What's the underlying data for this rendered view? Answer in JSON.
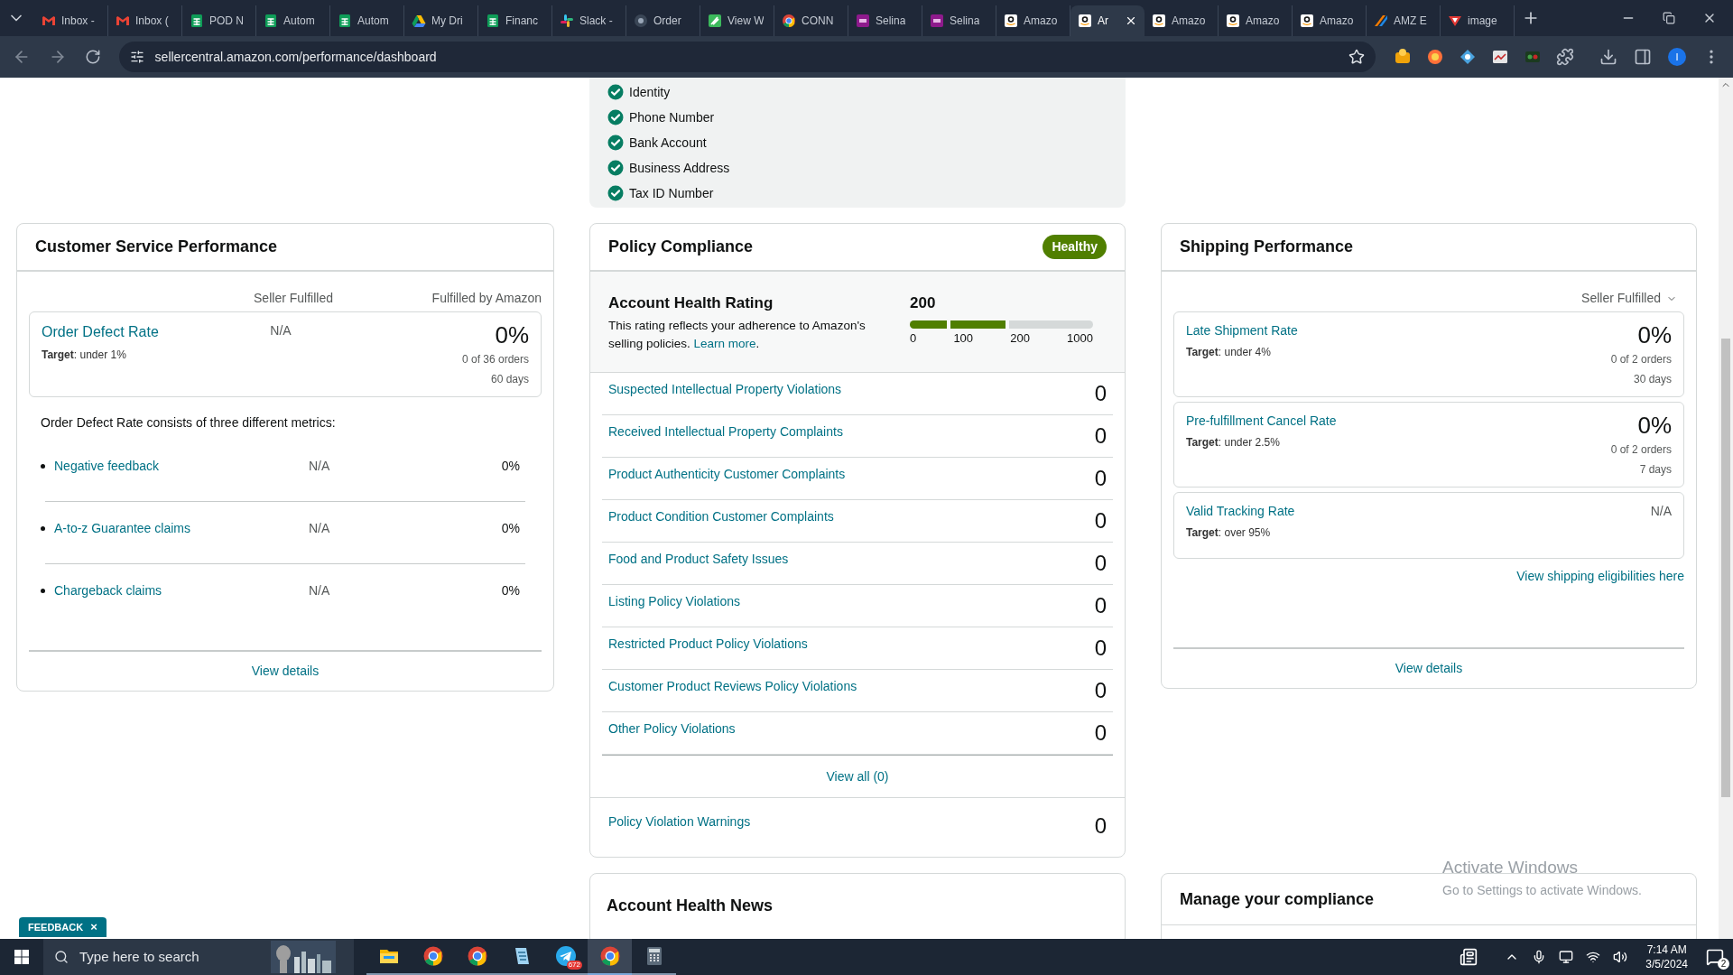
{
  "browser": {
    "tabs": [
      {
        "label": "Inbox -",
        "kind": "mail",
        "selected": false
      },
      {
        "label": "Inbox (",
        "kind": "mail",
        "selected": false
      },
      {
        "label": "POD N",
        "kind": "sheet",
        "selected": false
      },
      {
        "label": "Autom",
        "kind": "sheet",
        "selected": false
      },
      {
        "label": "Autom",
        "kind": "sheet",
        "selected": false
      },
      {
        "label": "My Dri",
        "kind": "drive",
        "selected": false
      },
      {
        "label": "Financ",
        "kind": "sheet",
        "selected": false
      },
      {
        "label": "Slack -",
        "kind": "slack",
        "selected": false
      },
      {
        "label": "Order",
        "kind": "disc",
        "selected": false
      },
      {
        "label": "View W",
        "kind": "leaf",
        "selected": false
      },
      {
        "label": "CONN",
        "kind": "chrome",
        "selected": false
      },
      {
        "label": "Selina",
        "kind": "tile",
        "selected": false
      },
      {
        "label": "Selina",
        "kind": "tile",
        "selected": false
      },
      {
        "label": "Amazo",
        "kind": "smile",
        "selected": false
      },
      {
        "label": "Ar",
        "kind": "smile",
        "selected": true
      },
      {
        "label": "Amazo",
        "kind": "smile",
        "selected": false
      },
      {
        "label": "Amazo",
        "kind": "smile",
        "selected": false
      },
      {
        "label": "Amazo",
        "kind": "smile",
        "selected": false
      },
      {
        "label": "AMZ E",
        "kind": "stripe",
        "selected": false
      },
      {
        "label": "image",
        "kind": "triangle",
        "selected": false
      }
    ],
    "url": "sellercentral.amazon.com/performance/dashboard",
    "profile": "I"
  },
  "verification": {
    "items": [
      {
        "label": "Identity",
        "checked": true
      },
      {
        "label": "Phone Number",
        "checked": true
      },
      {
        "label": "Bank Account",
        "checked": true
      },
      {
        "label": "Business Address",
        "checked": true
      },
      {
        "label": "Tax ID Number",
        "checked": true
      }
    ]
  },
  "customer_service": {
    "title": "Customer Service Performance",
    "columns": [
      "Seller Fulfilled",
      "Fulfilled by Amazon"
    ],
    "odr": {
      "name": "Order Defect Rate",
      "target": "**Target**: under 1%",
      "seller": "N/A",
      "fba": "0%",
      "orders": "0 of 36 orders",
      "period": "60 days"
    },
    "intro": "Order Defect Rate consists of three different metrics:",
    "metrics": [
      {
        "name": "Negative feedback",
        "seller": "N/A",
        "fba": "0%"
      },
      {
        "name": "A-to-z Guarantee claims",
        "seller": "N/A",
        "fba": "0%"
      },
      {
        "name": "Chargeback claims",
        "seller": "N/A",
        "fba": "0%"
      }
    ],
    "view_details": "View details"
  },
  "policy": {
    "title": "Policy Compliance",
    "status": "Healthy",
    "rating": {
      "title": "Account Health Rating",
      "description": "This rating reflects your adherence to Amazon's selling policies.",
      "link": "Learn more",
      "after_link": ".",
      "score": "200",
      "level": 0.52,
      "ticks": [
        "0",
        "100",
        "200",
        "1000"
      ]
    },
    "violations": [
      {
        "name": "Suspected Intellectual Property Violations",
        "count": "0"
      },
      {
        "name": "Received Intellectual Property Complaints",
        "count": "0"
      },
      {
        "name": "Product Authenticity Customer Complaints",
        "count": "0"
      },
      {
        "name": "Product Condition Customer Complaints",
        "count": "0"
      },
      {
        "name": "Food and Product Safety Issues",
        "count": "0"
      },
      {
        "name": "Listing Policy Violations",
        "count": "0"
      },
      {
        "name": "Restricted Product Policy Violations",
        "count": "0"
      },
      {
        "name": "Customer Product Reviews Policy Violations",
        "count": "0"
      },
      {
        "name": "Other Policy Violations",
        "count": "0"
      }
    ],
    "view_all": "View all (0)",
    "warnings": {
      "name": "Policy Violation Warnings",
      "count": "0"
    }
  },
  "shipping": {
    "title": "Shipping Performance",
    "filter": "Seller Fulfilled",
    "metrics": [
      {
        "name": "Late Shipment Rate",
        "target": "**Target**: under 4%",
        "value": "0%",
        "orders": "0 of 2 orders",
        "period": "30 days"
      },
      {
        "name": "Pre-fulfillment Cancel Rate",
        "target": "**Target**: under 2.5%",
        "value": "0%",
        "orders": "0 of 2 orders",
        "period": "7 days"
      },
      {
        "name": "Valid Tracking Rate",
        "target": "**Target**: over 95%",
        "value": "N/A"
      }
    ],
    "link": "View shipping eligibilities here",
    "view_details": "View details"
  },
  "news": {
    "title": "Account Health News"
  },
  "compliance": {
    "title": "Manage your compliance"
  },
  "feedback": {
    "label": "FEEDBACK",
    "close": "×"
  },
  "activation": {
    "title": "Activate Windows",
    "subtitle": "Go to Settings to activate Windows."
  },
  "taskbar": {
    "search_placeholder": "Type here to search",
    "apps": [
      {
        "kind": "folder",
        "selected": false
      },
      {
        "kind": "chrome",
        "selected": false
      },
      {
        "kind": "chrome",
        "selected": false
      },
      {
        "kind": "notepad",
        "selected": false
      },
      {
        "kind": "plane",
        "selected": false,
        "badge": "672"
      },
      {
        "kind": "chrome",
        "selected": true
      },
      {
        "kind": "calculator",
        "selected": false
      }
    ],
    "time": "7:14 AM",
    "date": "3/5/2024",
    "notifications": "2"
  }
}
